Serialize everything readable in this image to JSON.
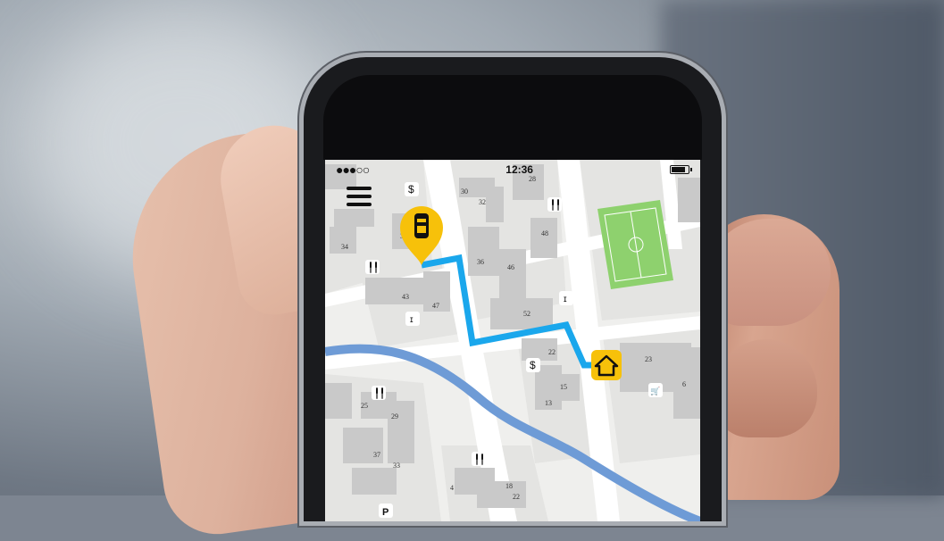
{
  "status_bar": {
    "signal": "●●●○○",
    "time": "12:36",
    "battery_level": 0.85
  },
  "map": {
    "building_numbers": [
      "30",
      "32",
      "28",
      "34",
      "32",
      "48",
      "36",
      "46",
      "43",
      "47",
      "52",
      "22",
      "23",
      "6",
      "15",
      "13",
      "25",
      "29",
      "37",
      "33",
      "4",
      "18",
      "22",
      "8",
      "6"
    ],
    "poi_icons": {
      "dollar": "$",
      "fork_knife": "╿╿",
      "tower": "ɪ",
      "cart": "🛒",
      "parking": "P"
    },
    "colors": {
      "route": "#1aa7ec",
      "river": "#6e9bd6",
      "pin": "#f7c10a",
      "park": "#8ed16e",
      "road": "#ffffff",
      "building": "#c9c9c9",
      "block": "#e3e3e1"
    }
  },
  "icons": {
    "menu": "menu-icon",
    "taxi": "taxi-pin-icon",
    "home": "home-destination-icon"
  }
}
